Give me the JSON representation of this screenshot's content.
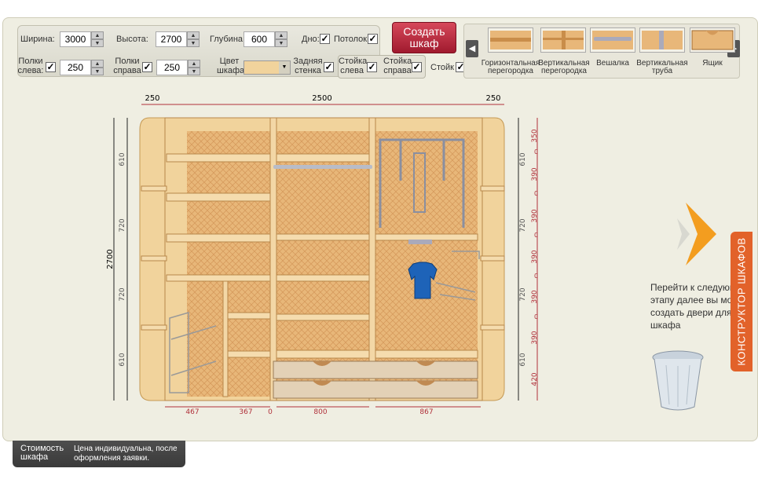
{
  "params": {
    "width_label": "Ширина:",
    "width_value": "3000",
    "height_label": "Высота:",
    "height_value": "2700",
    "depth_label": "Глубина:",
    "depth_value": "600",
    "bottom_label": "Дно:",
    "ceiling_label": "Потолок:",
    "shelves_left_label": "Полки слева:",
    "shelves_left_value": "250",
    "shelves_right_label": "Полки справа",
    "shelves_right_value": "250",
    "color_label": "Цвет шкафа",
    "back_label": "Задняя стенка",
    "stand_left_label": "Стойка слева",
    "stand_right_label": "Стойка справа",
    "stands_label": "Стойк",
    "check_mark": "✓"
  },
  "create_button": "Создать шкаф",
  "catalog": {
    "prev": "◀",
    "next": "▶",
    "items": [
      {
        "label": "Горизонтальная перегородка",
        "icon": "horizontal-partition-icon"
      },
      {
        "label": "Вертикальная перегородка",
        "icon": "vertical-partition-icon"
      },
      {
        "label": "Вешалка",
        "icon": "hanger-rod-icon"
      },
      {
        "label": "Вертикальная труба",
        "icon": "vertical-pipe-icon"
      },
      {
        "label": "Ящик",
        "icon": "drawer-icon"
      }
    ]
  },
  "drawing": {
    "top_dims": [
      "250",
      "2500",
      "250"
    ],
    "height_total": "2700",
    "left_dims": [
      "610",
      "720",
      "720",
      "610"
    ],
    "right_outer": [
      "350",
      "390",
      "390",
      "390",
      "390",
      "390",
      "420"
    ],
    "right_inner": [
      "610",
      "720",
      "720",
      "610"
    ],
    "right_small": [
      "0",
      "0",
      "0",
      "0",
      "0"
    ],
    "bottom_dims": [
      "467",
      "367",
      "0",
      "800",
      "867"
    ]
  },
  "next_step_text": [
    "Перейти к следующ",
    "этапу далее вы мож",
    "создать двери для в",
    "шкафа"
  ],
  "side_tab": "КОНСТРУКТОР ШКАФОВ",
  "cost": {
    "label": "Стоимость шкафа",
    "text": "Цена индивидуальна, после оформления заявки."
  },
  "colors": {
    "wood": "#f1d39c",
    "panel": "#e8b779",
    "accent": "#e2622a",
    "dim": "#b0303a"
  }
}
